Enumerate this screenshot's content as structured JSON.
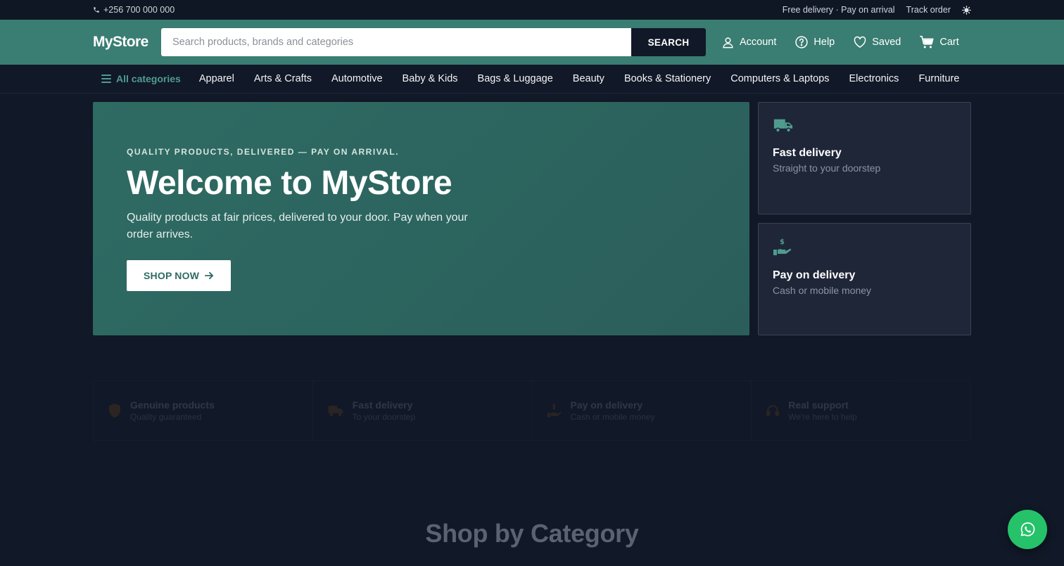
{
  "topbar": {
    "phone": "+256 700 000 000",
    "delivery_note": "Free delivery · Pay on arrival",
    "track_order": "Track order",
    "theme_icon": "sun-icon"
  },
  "header": {
    "logo": "MyStore",
    "search_placeholder": "Search products, brands and categories",
    "search_button": "SEARCH",
    "actions": {
      "account": "Account",
      "help": "Help",
      "saved": "Saved",
      "cart": "Cart"
    }
  },
  "nav": {
    "all_categories": "All categories",
    "categories": [
      "Apparel",
      "Arts & Crafts",
      "Automotive",
      "Baby & Kids",
      "Bags & Luggage",
      "Beauty",
      "Books & Stationery",
      "Computers & Laptops",
      "Electronics",
      "Furniture"
    ]
  },
  "hero": {
    "eyebrow": "QUALITY PRODUCTS, DELIVERED — PAY ON ARRIVAL.",
    "title": "Welcome to MyStore",
    "description": "Quality products at fair prices, delivered to your door. Pay when your order arrives.",
    "cta": "SHOP NOW"
  },
  "side_cards": [
    {
      "title": "Fast delivery",
      "subtitle": "Straight to your doorstep",
      "icon": "truck-icon"
    },
    {
      "title": "Pay on delivery",
      "subtitle": "Cash or mobile money",
      "icon": "cash-hand-icon"
    }
  ],
  "features": [
    {
      "title": "Genuine products",
      "subtitle": "Quality guaranteed",
      "icon": "shield-icon"
    },
    {
      "title": "Fast delivery",
      "subtitle": "To your doorstep",
      "icon": "truck-icon"
    },
    {
      "title": "Pay on delivery",
      "subtitle": "Cash or mobile money",
      "icon": "cash-hand-icon"
    },
    {
      "title": "Real support",
      "subtitle": "We're here to help",
      "icon": "headset-icon"
    }
  ],
  "section_title": "Shop by Category",
  "colors": {
    "brand": "#3a7d72",
    "accent": "#4f9c8e",
    "dark": "#111827",
    "whatsapp": "#25c26a",
    "feature_icon": "#d97706"
  }
}
